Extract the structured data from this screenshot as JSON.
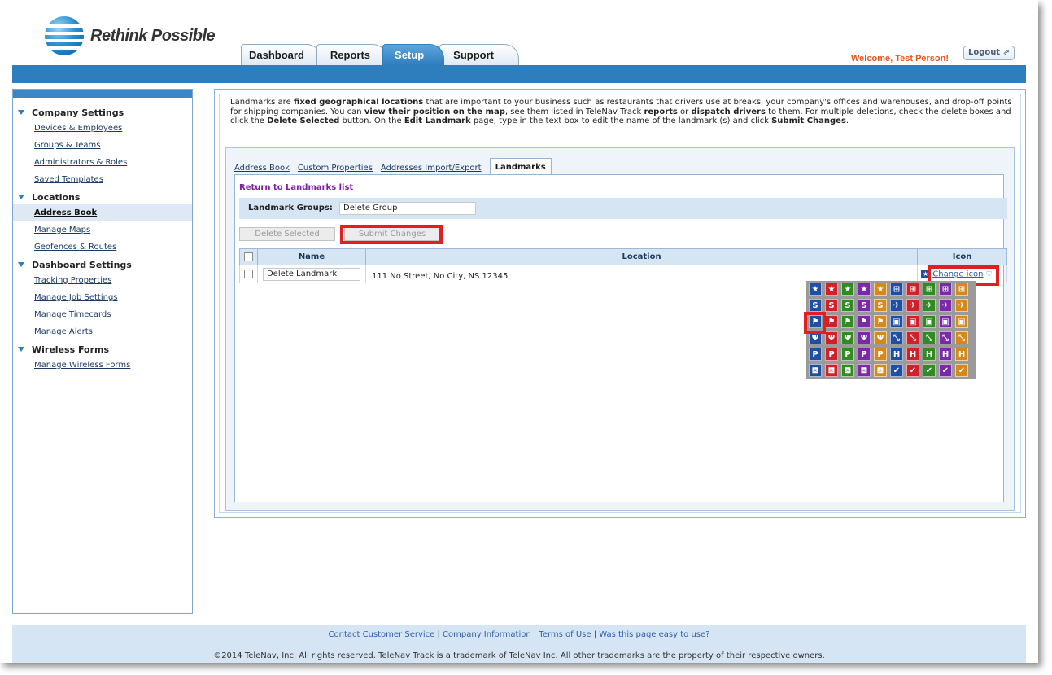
{
  "header": {
    "brand": "Rethink Possible",
    "tabs": [
      {
        "label": "Dashboard",
        "active": false
      },
      {
        "label": "Reports",
        "active": false
      },
      {
        "label": "Setup",
        "active": true
      },
      {
        "label": "Support",
        "active": false
      }
    ],
    "welcome": "Welcome, Test Person!",
    "logout_label": "Logout"
  },
  "sidebar": {
    "sections": [
      {
        "title": "Company Settings",
        "items": [
          "Devices & Employees",
          "Groups & Teams",
          "Administrators & Roles",
          "Saved Templates"
        ]
      },
      {
        "title": "Locations",
        "items": [
          "Address Book",
          "Manage Maps",
          "Geofences & Routes"
        ]
      },
      {
        "title": "Dashboard Settings",
        "items": [
          "Tracking Properties",
          "Manage Job Settings",
          "Manage Timecards",
          "Manage Alerts"
        ]
      },
      {
        "title": "Wireless Forms",
        "items": [
          "Manage Wireless Forms"
        ]
      }
    ],
    "active_item": "Address Book"
  },
  "intro": {
    "p1": "Landmarks are ",
    "b1": "fixed geographical locations",
    "p2": " that are important to your business such as restaurants that drivers use at breaks, your company's offices and warehouses, and drop-off points for shipping companies. You can ",
    "b2": "view their position on the map",
    "p3": ", see them listed in TeleNav Track ",
    "b3": "reports",
    "p4": " or ",
    "b4": "dispatch drivers",
    "p5": " to them. For multiple deletions, check the delete boxes and click the ",
    "b5": "Delete Selected",
    "p6": " button. On the ",
    "b6": "Edit Landmark",
    "p7": " page, type in the text box to edit the name of the landmark (s) and click ",
    "b7": "Submit Changes",
    "p8": "."
  },
  "subtabs": [
    {
      "label": "Address Book",
      "active": false
    },
    {
      "label": "Custom Properties",
      "active": false
    },
    {
      "label": "Addresses Import/Export",
      "active": false
    },
    {
      "label": "Landmarks",
      "active": true
    }
  ],
  "landmarks": {
    "return_link": "Return to Landmarks list",
    "groups_label": "Landmark Groups:",
    "groups_value": "Delete Group",
    "delete_selected": "Delete Selected",
    "submit_changes": "Submit Changes",
    "columns": [
      "Name",
      "Location",
      "Icon"
    ],
    "rows": [
      {
        "name": "Delete Landmark",
        "location": "111 No Street, No City, NS 12345",
        "icon_link": "Change icon"
      }
    ]
  },
  "icon_picker": {
    "colors": [
      "#1f4fa3",
      "#d21f2a",
      "#2f8c1f",
      "#7a2aa8",
      "#d6891a"
    ],
    "rows": [
      {
        "glyphs": [
          "★",
          "★",
          "★",
          "★",
          "★",
          "⊞",
          "⊞",
          "⊞",
          "⊞",
          "⊞"
        ]
      },
      {
        "glyphs": [
          "S",
          "S",
          "S",
          "S",
          "S",
          "✈",
          "✈",
          "✈",
          "✈",
          "✈"
        ]
      },
      {
        "glyphs": [
          "⚑",
          "⚑",
          "⚑",
          "⚑",
          "⚑",
          "▣",
          "▣",
          "▣",
          "▣",
          "▣"
        ]
      },
      {
        "glyphs": [
          "Ψ",
          "Ψ",
          "Ψ",
          "Ψ",
          "Ψ",
          "⤡",
          "⤡",
          "⤡",
          "⤡",
          "⤡"
        ]
      },
      {
        "glyphs": [
          "P",
          "P",
          "P",
          "P",
          "P",
          "H",
          "H",
          "H",
          "H",
          "H"
        ]
      },
      {
        "glyphs": [
          "⛾",
          "⛾",
          "⛾",
          "⛾",
          "⛾",
          "✔",
          "✔",
          "✔",
          "✔",
          "✔"
        ]
      }
    ],
    "selected": "row 3, column 1"
  },
  "footer": {
    "links": [
      "Contact Customer Service",
      "Company Information",
      "Terms of Use",
      "Was this page easy to use?"
    ],
    "copyright": "©2014 TeleNav, Inc. All rights reserved. TeleNav Track is a trademark of TeleNav Inc. All other trademarks are the property of their respective owners."
  },
  "colors": {
    "brand_blue": "#2e7dbd",
    "highlight_red": "#e01f1f",
    "welcome_orange": "#e8531f"
  }
}
